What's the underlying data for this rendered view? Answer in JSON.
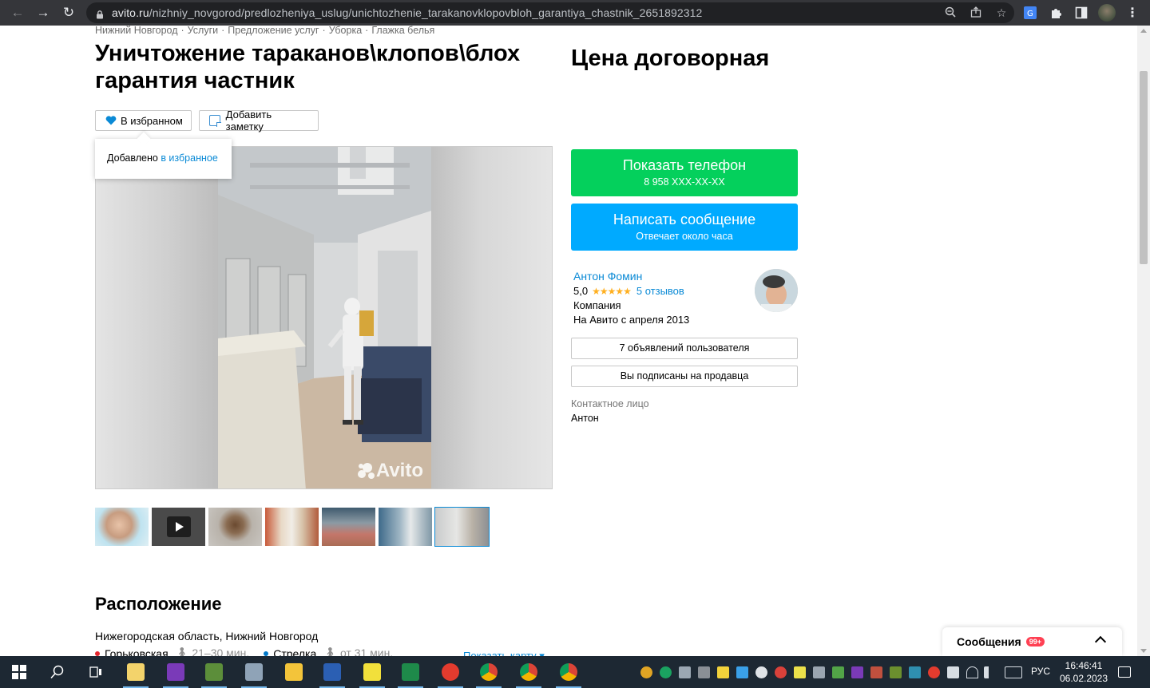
{
  "browser": {
    "url_host": "avito.ru",
    "url_path": "/nizhniy_novgorod/predlozheniya_uslug/unichtozhenie_tarakanovklopovbloh_garantiya_chastnik_2651892312"
  },
  "breadcrumbs": [
    "Нижний Новгород",
    "Услуги",
    "Предложение услуг",
    "Уборка",
    "Глажка белья"
  ],
  "breadcrumb_separator": "·",
  "listing": {
    "title": "Уничтожение тараканов\\клопов\\блох гарантия частник",
    "price": "Цена договорная",
    "watermark": "Avito"
  },
  "actions": {
    "favorite_label": "В избранном",
    "note_label": "Добавить заметку",
    "tooltip_text": "Добавлено ",
    "tooltip_link": "в избранное"
  },
  "contact": {
    "phone_label": "Показать телефон",
    "phone_masked": "8 958 XXX-XX-XX",
    "message_label": "Написать сообщение",
    "message_sub": "Отвечает около часа"
  },
  "seller": {
    "name": "Антон Фомин",
    "rating": "5,0",
    "stars": "★★★★★",
    "reviews": "5 отзывов",
    "type": "Компания",
    "since": "На Авито с апреля 2013",
    "ads_button": "7 объявлений пользователя",
    "subscribed_button": "Вы подписаны на продавца",
    "contact_person_label": "Контактное лицо",
    "contact_person": "Антон"
  },
  "location": {
    "title": "Расположение",
    "address": "Нижегородская область, Нижний Новгород",
    "metro": [
      {
        "name": "Горьковская",
        "time": "21–30 мин.",
        "color": "#e4252c"
      },
      {
        "name": "Стрелка",
        "time": "от 31 мин.",
        "color": "#0078c9"
      }
    ],
    "show_map": "Показать карту ▾"
  },
  "messenger": {
    "label": "Сообщения",
    "badge": "99+"
  },
  "taskbar": {
    "lang": "РУС",
    "time": "16:46:41",
    "date": "06.02.2023"
  },
  "colors": {
    "avito_green": "#04d05c",
    "avito_blue": "#00aaff",
    "link_blue": "#0a8ad6",
    "star_yellow": "#ffb021"
  }
}
